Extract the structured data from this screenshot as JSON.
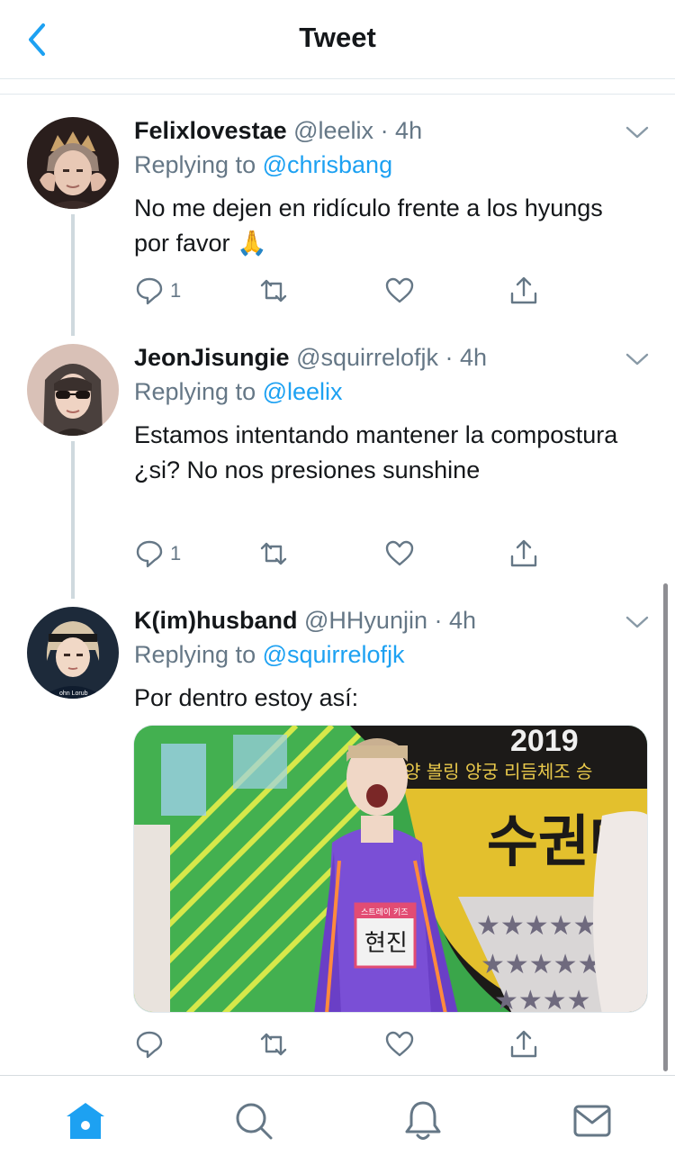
{
  "header": {
    "title": "Tweet"
  },
  "colors": {
    "accent": "#1da1f2",
    "text": "#14171a",
    "muted": "#657786"
  },
  "tweets": [
    {
      "name": "Felixlovestae",
      "handle": "@leelix",
      "time": "· 4h",
      "replying_prefix": "Replying to",
      "replying_to": "@chrisbang",
      "text": "No me dejen en ridículo frente a los hyungs por favor 🙏",
      "reply_count": "1"
    },
    {
      "name": "JeonJisungie",
      "handle": "@squirrelofjk",
      "time": "· 4h",
      "replying_prefix": "Replying to",
      "replying_to": "@leelix",
      "text": "Estamos intentando mantener la compostura ¿si? No nos presiones sunshine",
      "reply_count": "1"
    },
    {
      "name": "K(im)husband",
      "handle": "@HHyunjin",
      "time": "· 4h",
      "replying_prefix": "Replying to",
      "replying_to": "@squirrelofjk",
      "text": "Por dentro estoy así:",
      "reply_count": ""
    }
  ],
  "media": {
    "banner_year": "2019",
    "banner_line": "양 볼링 양궁 리듬체조 승",
    "banner_big": "수권대",
    "name_tag_small": "스트레이 키즈",
    "name_tag": "현진"
  },
  "tabbar": [
    "home-icon",
    "search-icon",
    "notifications-icon",
    "messages-icon"
  ]
}
